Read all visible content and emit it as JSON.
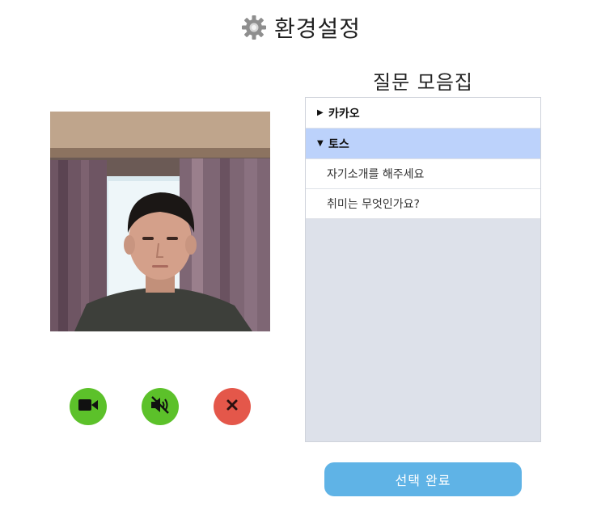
{
  "header": {
    "title": "환경설정",
    "icon": "gear-icon"
  },
  "video": {
    "label": "camera-preview"
  },
  "controls": {
    "camera_icon": "video-camera-icon",
    "mic_icon": "speaker-muted-icon",
    "close_icon": "close-icon",
    "colors": {
      "active": "#5cc12a",
      "danger": "#e4574a"
    }
  },
  "questions": {
    "title": "질문 모음집",
    "categories": [
      {
        "label": "카카오",
        "expanded": false,
        "items": []
      },
      {
        "label": "토스",
        "expanded": true,
        "items": [
          "자기소개를 해주세요",
          "취미는 무엇인가요?"
        ]
      }
    ]
  },
  "submit": {
    "label": "선택 완료",
    "color": "#5fb3e6"
  }
}
